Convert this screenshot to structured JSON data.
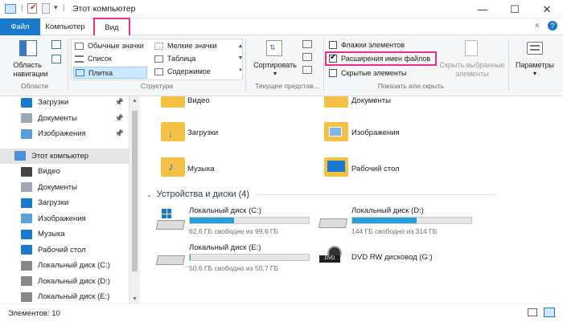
{
  "window": {
    "title": "Этот компьютер",
    "controls": [
      "—",
      "☐",
      "✕"
    ]
  },
  "tabs": {
    "file": "Файл",
    "computer": "Компьютер",
    "view": "Вид"
  },
  "ribbon": {
    "panes": {
      "nav_label_1": "Область",
      "nav_label_2": "навигации",
      "group": "Области"
    },
    "layout": {
      "items": [
        "Обычные значки",
        "Мелкие значки",
        "Список",
        "Таблица",
        "Плитка",
        "Содержимое"
      ],
      "group": "Структура"
    },
    "current_view": {
      "sort_label": "Сортировать",
      "group": "Текущее представ..."
    },
    "show_hide": {
      "item_checkboxes": "Флажки элементов",
      "file_extensions": "Расширения имен файлов",
      "hidden_items": "Скрытые элементы",
      "hide_selected_1": "Скрыть выбранные",
      "hide_selected_2": "элементы",
      "group": "Показать или скрыть"
    },
    "options": {
      "label": "Параметры"
    }
  },
  "nav": {
    "items": [
      {
        "label": "Загрузки",
        "icon": "download-icon",
        "pinned": true
      },
      {
        "label": "Документы",
        "icon": "documents-icon",
        "pinned": true
      },
      {
        "label": "Изображения",
        "icon": "pictures-icon",
        "pinned": true
      },
      {
        "label": "Этот компьютер",
        "icon": "computer-icon",
        "pinned": false
      },
      {
        "label": "Видео",
        "icon": "video-icon",
        "pinned": false
      },
      {
        "label": "Документы",
        "icon": "documents-icon",
        "pinned": false
      },
      {
        "label": "Загрузки",
        "icon": "download-icon",
        "pinned": false
      },
      {
        "label": "Изображения",
        "icon": "pictures-icon",
        "pinned": false
      },
      {
        "label": "Музыка",
        "icon": "music-icon",
        "pinned": false
      },
      {
        "label": "Рабочий стол",
        "icon": "desktop-icon",
        "pinned": false
      },
      {
        "label": "Локальный диск (C:)",
        "icon": "drive-icon",
        "pinned": false
      },
      {
        "label": "Локальный диск (D:)",
        "icon": "drive-icon",
        "pinned": false
      },
      {
        "label": "Локальный диск (E:)",
        "icon": "drive-icon",
        "pinned": false
      }
    ]
  },
  "folders": [
    {
      "label": "Видео"
    },
    {
      "label": "Документы"
    },
    {
      "label": "Загрузки"
    },
    {
      "label": "Изображения"
    },
    {
      "label": "Музыка"
    },
    {
      "label": "Рабочий стол"
    }
  ],
  "devices": {
    "title": "Устройства и диски (4)",
    "drives": [
      {
        "name": "Локальный диск (C:)",
        "free": "62,6 ГБ свободно из 99,6 ГБ",
        "used_fraction": 0.37
      },
      {
        "name": "Локальный диск (D:)",
        "free": "144 ГБ свободно из 314 ГБ",
        "used_fraction": 0.54
      },
      {
        "name": "Локальный диск (E:)",
        "free": "50,6 ГБ свободно из 50,7 ГБ",
        "used_fraction": 0.01
      },
      {
        "name": "DVD RW дисковод (G:)",
        "free": "",
        "used_fraction": null
      }
    ]
  },
  "status": {
    "items": "Элементов: 10"
  },
  "colors": {
    "accent": "#1979ca",
    "highlight": "#e6308a",
    "folder": "#f4c146",
    "drive_fill": "#26a0da"
  }
}
